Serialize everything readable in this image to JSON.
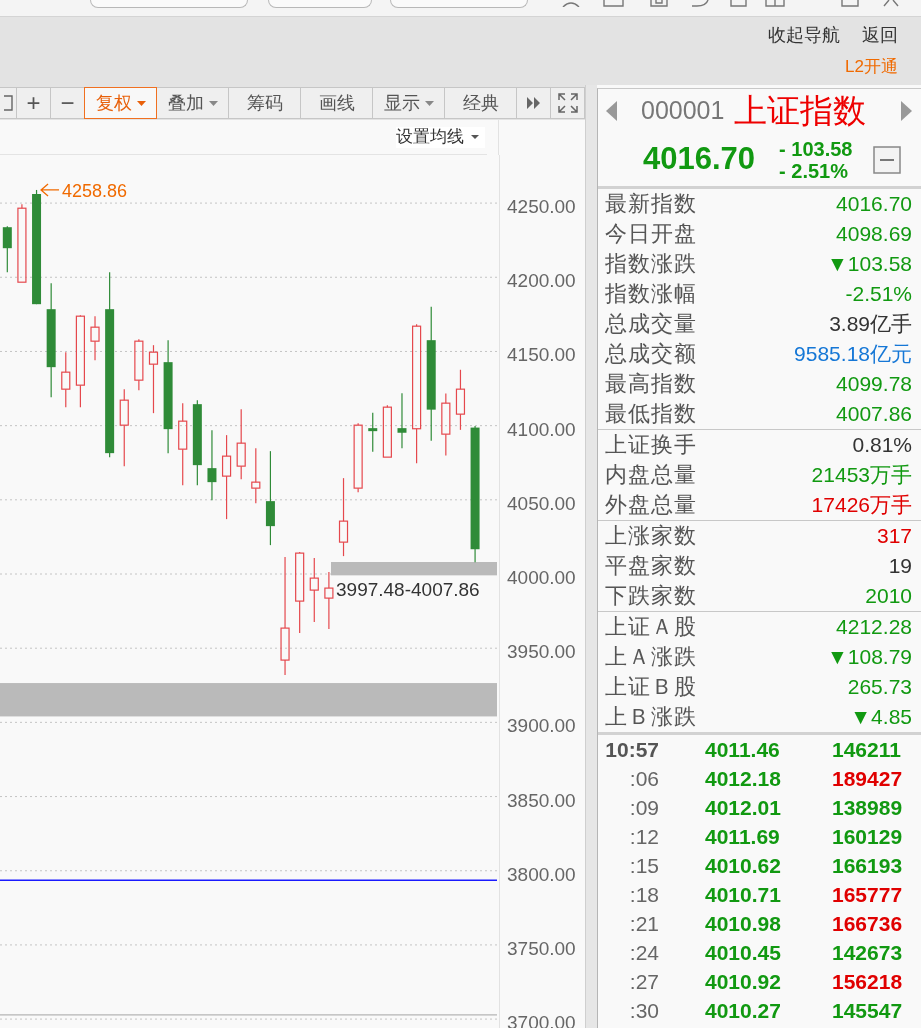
{
  "nav": {
    "links": [
      {
        "label": "收起导航"
      },
      {
        "label": "返回"
      }
    ],
    "promo": "L2开通"
  },
  "toolbar": {
    "buttons": [
      {
        "kind": "symbol",
        "label": "+",
        "dropdown": false,
        "selected": false
      },
      {
        "kind": "symbol",
        "label": "−",
        "dropdown": false,
        "selected": false
      },
      {
        "kind": "text",
        "label": "复权",
        "dropdown": true,
        "selected": true
      },
      {
        "kind": "text",
        "label": "叠加",
        "dropdown": true,
        "selected": false
      },
      {
        "kind": "text",
        "label": "筹码",
        "dropdown": false,
        "selected": false
      },
      {
        "kind": "text",
        "label": "画线",
        "dropdown": false,
        "selected": false
      },
      {
        "kind": "text",
        "label": "显示",
        "dropdown": true,
        "selected": false
      },
      {
        "kind": "text",
        "label": "经典",
        "dropdown": false,
        "selected": false
      }
    ]
  },
  "chart": {
    "ma_button": "设置均线",
    "peak_label": "4258.86",
    "chart_data": {
      "type": "candlestick",
      "categories": [
        null,
        null,
        null,
        null,
        null,
        null,
        null,
        null,
        null,
        null,
        null,
        null,
        null,
        null,
        null,
        null,
        null,
        null,
        null,
        null,
        null,
        null,
        null,
        null,
        null,
        null,
        null,
        null,
        null,
        null,
        null,
        null,
        null,
        null
      ],
      "ohlc": [
        [
          4233.76,
          4234.43,
          4203.43,
          4219.61
        ],
        [
          4196.69,
          4249.25,
          4196.69,
          4246.56
        ],
        [
          4256.13,
          4258.86,
          4181.87,
          4181.87
        ],
        [
          4178.5,
          4196.02,
          4119.2,
          4139.42
        ],
        [
          4124.59,
          4149.52,
          4112.46,
          4136.05
        ],
        [
          4127.29,
          4174.46,
          4112.46,
          4173.78
        ],
        [
          4156.94,
          4173.78,
          4144.13,
          4166.37
        ],
        [
          4178.5,
          4203.43,
          4078.77,
          4081.47
        ],
        [
          4100.33,
          4124.59,
          4072.71,
          4117.18
        ],
        [
          4130.66,
          4158.28,
          4123.92,
          4156.94
        ],
        [
          4141.44,
          4154.24,
          4108.42,
          4149.52
        ],
        [
          4142.79,
          4157.61,
          4081.47,
          4097.64
        ],
        [
          4084.16,
          4115.16,
          4059.9,
          4103.03
        ],
        [
          4114.48,
          4117.18,
          4059.9,
          4073.38
        ],
        [
          4071.36,
          4096.96,
          4049.79,
          4061.92
        ],
        [
          4065.97,
          4093.6,
          4036.99,
          4079.44
        ],
        [
          4072.71,
          4111.12,
          4063.95,
          4088.2
        ],
        [
          4057.88,
          4084.84,
          4047.77,
          4061.92
        ],
        [
          4049.12,
          4082.81,
          4019.47,
          4032.27
        ],
        [
          3941.98,
          4011.39,
          3931.87,
          3963.54
        ],
        [
          3981.74,
          4014.75,
          3960.17,
          4014.08
        ],
        [
          3989.15,
          4010.71,
          3967.59,
          3997.23
        ],
        [
          3983.76,
          4001.28,
          3962.87,
          3990.5
        ],
        [
          4021.49,
          4064.62,
          4012.06,
          4035.64
        ],
        [
          4057.88,
          4101.68,
          4055.19,
          4100.33
        ],
        [
          4098.31,
          4108.76,
          4082.41,
          4096.29
        ],
        [
          4078.77,
          4113.81,
          4078.77,
          4112.46
        ],
        [
          4098.31,
          4121.9,
          4084.84,
          4095.21
        ],
        [
          4097.91,
          4168.39,
          4074.73,
          4167.04
        ],
        [
          4157.61,
          4180.12,
          4089.89,
          4110.78
        ],
        [
          4094.27,
          4121.63,
          4079.85,
          4115.16
        ],
        [
          4107.75,
          4137.66,
          4097.17,
          4124.59
        ],
        [
          4098.69,
          4099.78,
          4007.86,
          4016.7
        ],
        null
      ],
      "ylim": [
        3694.0,
        4282.42
      ],
      "yticks": [
        {
          "value": 4250,
          "label": "4250.00"
        },
        {
          "value": 4200,
          "label": "4200.00"
        },
        {
          "value": 4150,
          "label": "4150.00"
        },
        {
          "value": 4100,
          "label": "4100.00"
        },
        {
          "value": 4050,
          "label": "4050.00"
        },
        {
          "value": 4000,
          "label": "4000.00"
        },
        {
          "value": 3950,
          "label": "3950.00"
        },
        {
          "value": 3900,
          "label": "3900.00"
        },
        {
          "value": 3850,
          "label": "3850.00"
        },
        {
          "value": 3800,
          "label": "3800.00"
        },
        {
          "value": 3750,
          "label": "3750.00"
        },
        {
          "value": 3700,
          "label": "3700.00"
        }
      ],
      "grid": true,
      "bands": [
        {
          "axis": "y",
          "from": 3999.1,
          "to": 4008.1,
          "label": "3997.48-4007.86"
        },
        {
          "axis": "y",
          "from": 3904.0,
          "to": 3926.5
        }
      ],
      "ref_lines": [
        {
          "axis": "y",
          "value": 3793.6,
          "color": "#1a1aff"
        },
        {
          "axis": "y",
          "value": 3702.8,
          "color": "#b4b4b4"
        }
      ]
    }
  },
  "quote": {
    "code": "000001",
    "name": "上证指数",
    "price": "4016.70",
    "change": "- 103.58",
    "change_percent": "- 2.51%"
  },
  "stat_groups": [
    {
      "rows": [
        {
          "label": "最新指数",
          "value": "4016.70",
          "color": "#119911"
        },
        {
          "label": "今日开盘",
          "value": "4098.69",
          "color": "#119911"
        },
        {
          "label": "指数涨跌",
          "value": "▼103.58",
          "color": "#119911"
        },
        {
          "label": "指数涨幅",
          "value": "-2.51%",
          "color": "#119911"
        },
        {
          "label": "总成交量",
          "value": "3.89亿手",
          "color": "#333333"
        },
        {
          "label": "总成交额",
          "value": "9585.18亿元",
          "color": "#1577d6"
        },
        {
          "label": "最高指数",
          "value": "4099.78",
          "color": "#119911"
        },
        {
          "label": "最低指数",
          "value": "4007.86",
          "color": "#119911"
        }
      ]
    },
    {
      "rows": [
        {
          "label": "上证换手",
          "value": "0.81%",
          "color": "#333333"
        },
        {
          "label": "内盘总量",
          "value": "21453万手",
          "color": "#119911"
        },
        {
          "label": "外盘总量",
          "value": "17426万手",
          "color": "#e00000"
        }
      ]
    },
    {
      "rows": [
        {
          "label": "上涨家数",
          "value": "317",
          "color": "#e00000"
        },
        {
          "label": "平盘家数",
          "value": "19",
          "color": "#333333"
        },
        {
          "label": "下跌家数",
          "value": "2010",
          "color": "#119911"
        }
      ]
    },
    {
      "rows": [
        {
          "label": "上证Ａ股",
          "value": "4212.28",
          "color": "#119911"
        },
        {
          "label": "上Ａ涨跌",
          "value": "▼108.79",
          "color": "#119911"
        },
        {
          "label": "上证Ｂ股",
          "value": "265.73",
          "color": "#119911"
        },
        {
          "label": "上Ｂ涨跌",
          "value": "▼4.85",
          "color": "#119911"
        }
      ]
    }
  ],
  "ticks": [
    {
      "kind": "minute",
      "time": "10:57",
      "price": "4011.46",
      "volume": "146211",
      "color": "#119911"
    },
    {
      "kind": "second",
      "time": ":06",
      "price": "4012.18",
      "volume": "189427",
      "color": "#e00000"
    },
    {
      "kind": "second",
      "time": ":09",
      "price": "4012.01",
      "volume": "138989",
      "color": "#119911"
    },
    {
      "kind": "second",
      "time": ":12",
      "price": "4011.69",
      "volume": "160129",
      "color": "#119911"
    },
    {
      "kind": "second",
      "time": ":15",
      "price": "4010.62",
      "volume": "166193",
      "color": "#119911"
    },
    {
      "kind": "second",
      "time": ":18",
      "price": "4010.71",
      "volume": "165777",
      "color": "#e00000"
    },
    {
      "kind": "second",
      "time": ":21",
      "price": "4010.98",
      "volume": "166736",
      "color": "#e00000"
    },
    {
      "kind": "second",
      "time": ":24",
      "price": "4010.45",
      "volume": "142673",
      "color": "#119911"
    },
    {
      "kind": "second",
      "time": ":27",
      "price": "4010.92",
      "volume": "156218",
      "color": "#e00000"
    },
    {
      "kind": "second",
      "time": ":30",
      "price": "4010.27",
      "volume": "145547",
      "color": "#119911"
    }
  ]
}
